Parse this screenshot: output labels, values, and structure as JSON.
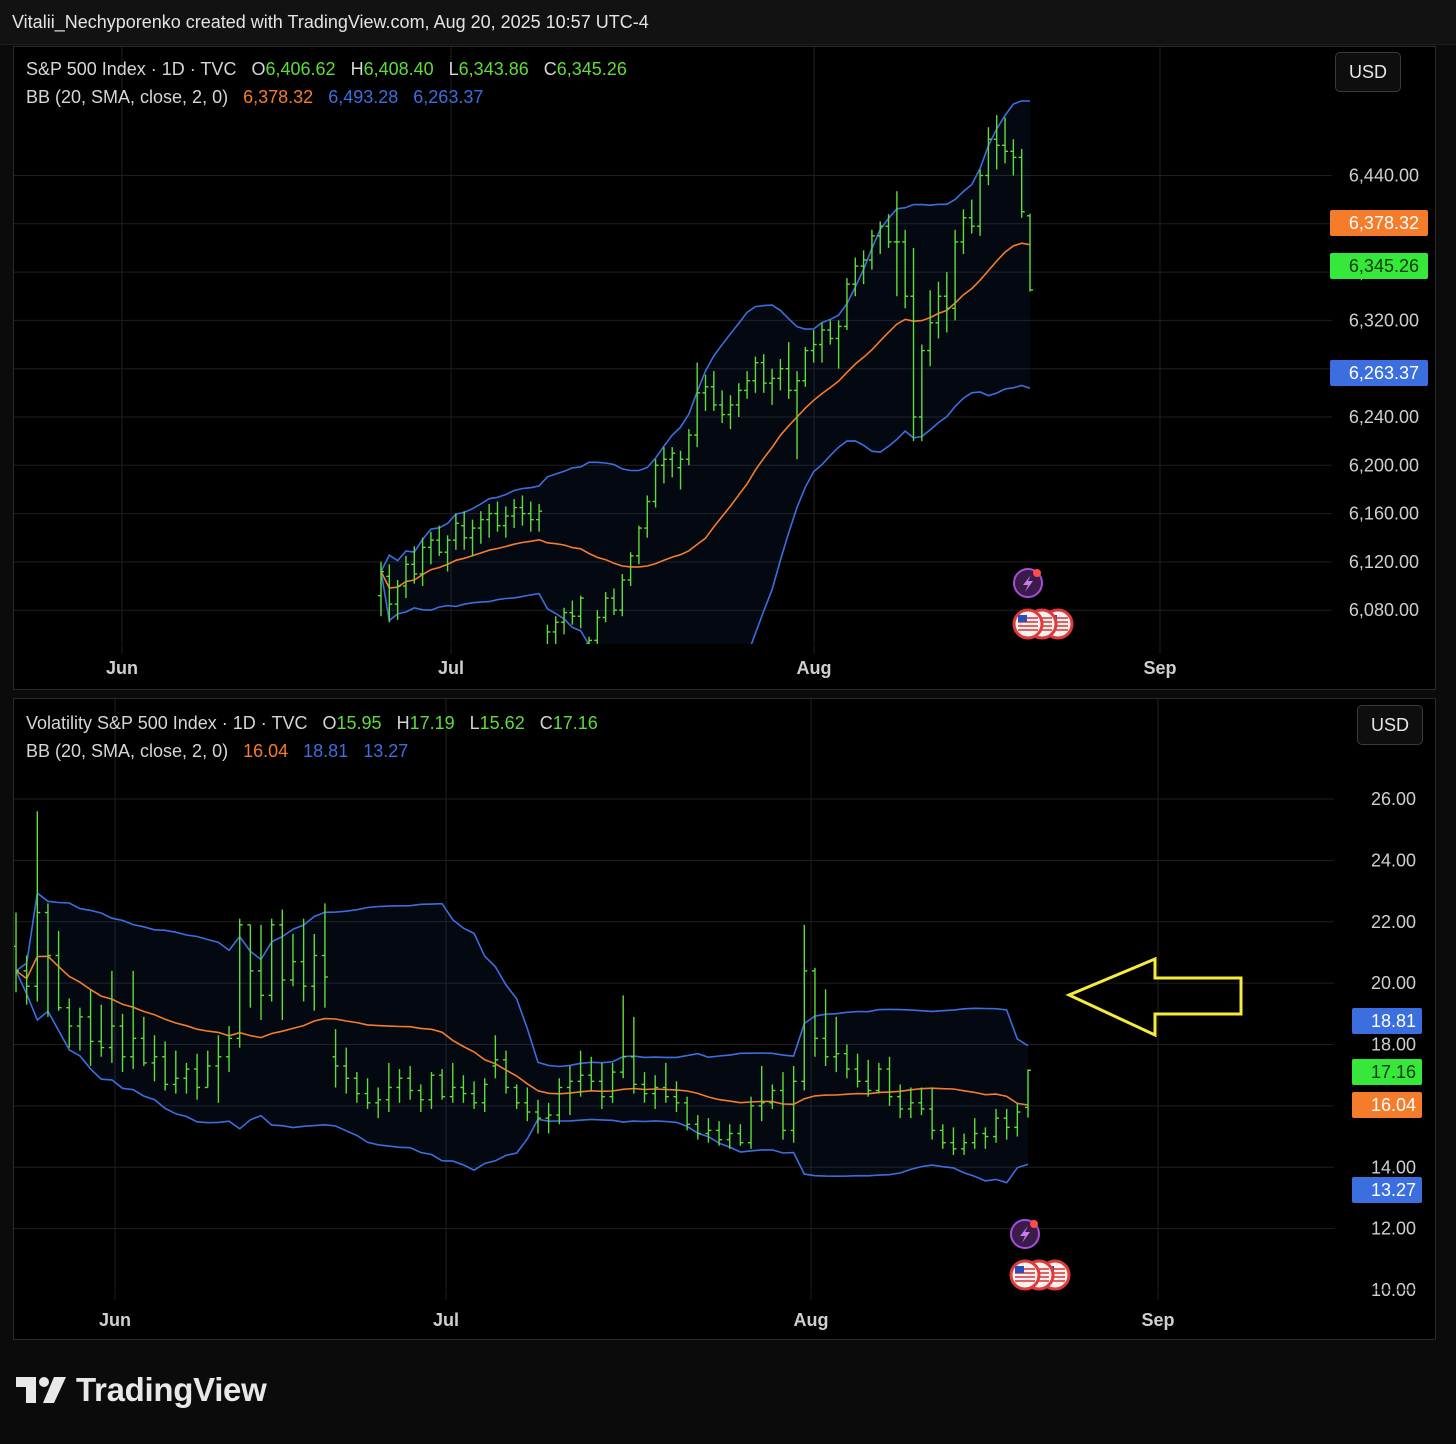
{
  "header": {
    "attribution": "Vitalii_Nechyporenko created with TradingView.com, Aug 20, 2025 10:57 UTC-4"
  },
  "branding": {
    "logo_text": "TradingView"
  },
  "colors": {
    "up_bar": "#5fdc3a",
    "bb_basis": "#f57c2a",
    "bb_band": "#3b6fe0",
    "arrow": "#f5ec3b",
    "background": "#000000"
  },
  "panels": [
    {
      "symbol_line": {
        "name": "S&P 500 Index · 1D · TVC",
        "o_label": "O",
        "o": "6,406.62",
        "h_label": "H",
        "h": "6,408.40",
        "l_label": "L",
        "l": "6,343.86",
        "c_label": "C",
        "c": "6,345.26"
      },
      "bb_line": {
        "label": "BB (20, SMA, close, 2, 0)",
        "basis": "6,378.32",
        "upper": "6,493.28",
        "lower": "6,263.37"
      },
      "currency": "USD",
      "price_tags": [
        {
          "value": "6,378.32",
          "color": "#f57c2a"
        },
        {
          "value": "6,345.26",
          "color": "#35e83a"
        },
        {
          "value": "6,263.37",
          "color": "#3b6fe0"
        }
      ]
    },
    {
      "symbol_line": {
        "name": "Volatility S&P 500 Index · 1D · TVC",
        "o_label": "O",
        "o": "15.95",
        "h_label": "H",
        "h": "17.19",
        "l_label": "L",
        "l": "15.62",
        "c_label": "C",
        "c": "17.16"
      },
      "bb_line": {
        "label": "BB (20, SMA, close, 2, 0)",
        "basis": "16.04",
        "upper": "18.81",
        "lower": "13.27"
      },
      "currency": "USD",
      "price_tags": [
        {
          "value": "18.81",
          "color": "#3b6fe0"
        },
        {
          "value": "17.16",
          "color": "#35e83a"
        },
        {
          "value": "16.04",
          "color": "#f57c2a"
        },
        {
          "value": "13.27",
          "color": "#3b6fe0"
        }
      ]
    }
  ],
  "chart_data": [
    {
      "type": "ohlc",
      "title": "S&P 500 Index · 1D · TVC",
      "x_ticks": [
        "Jun",
        "Jul",
        "Aug",
        "Sep"
      ],
      "y_ticks": [
        "6,080.00",
        "6,120.00",
        "6,160.00",
        "6,200.00",
        "6,240.00",
        "6,280.00",
        "6,320.00",
        "6,360.00",
        "6,400.00",
        "6,440.00"
      ],
      "ylim": [
        6052,
        6505
      ],
      "bar_days": [
        26,
        27,
        28,
        29,
        30,
        33,
        34,
        35,
        36,
        37,
        40,
        41,
        42,
        43,
        44,
        47,
        48,
        49,
        50,
        51,
        54,
        55,
        56,
        57,
        58,
        61,
        62,
        63,
        64,
        65,
        68,
        69,
        70,
        71,
        72,
        75,
        76,
        77,
        78,
        79,
        82,
        83,
        84,
        85,
        86,
        89,
        90,
        91,
        92,
        93,
        96,
        97,
        98,
        99,
        100,
        103,
        104,
        105,
        106,
        107,
        110,
        111,
        112,
        113,
        114,
        117,
        118,
        119,
        120,
        121,
        124,
        125,
        126,
        127,
        128,
        131,
        132,
        133,
        134,
        135,
        138,
        139,
        140,
        141,
        142,
        145,
        146,
        147,
        148,
        149,
        152,
        153,
        154,
        155,
        156,
        159,
        160,
        161,
        162,
        163,
        166,
        167,
        168,
        169,
        170,
        173,
        174,
        175,
        176,
        177,
        180,
        181,
        182,
        183,
        184,
        187,
        188,
        189,
        190,
        191,
        194,
        195,
        196,
        197,
        198,
        201,
        202,
        203,
        204,
        205,
        208,
        209,
        210,
        211,
        212,
        215,
        216,
        217,
        218,
        219,
        222,
        223,
        224,
        225,
        226,
        229,
        230,
        231,
        232
      ],
      "ohlc": [
        [
          6092,
          6120,
          6075,
          6112
        ],
        [
          6108,
          6118,
          6070,
          6085
        ],
        [
          6085,
          6105,
          6072,
          6100
        ],
        [
          6100,
          6125,
          6090,
          6118
        ],
        [
          6118,
          6133,
          6102,
          6110
        ],
        [
          6110,
          6140,
          6100,
          6132
        ],
        [
          6132,
          6145,
          6118,
          6138
        ],
        [
          6138,
          6150,
          6125,
          6128
        ],
        [
          6128,
          6142,
          6112,
          6138
        ],
        [
          6138,
          6160,
          6130,
          6152
        ],
        [
          6150,
          6162,
          6130,
          6140
        ],
        [
          6140,
          6155,
          6125,
          6148
        ],
        [
          6148,
          6162,
          6135,
          6155
        ],
        [
          6155,
          6168,
          6140,
          6160
        ],
        [
          6160,
          6170,
          6145,
          6150
        ],
        [
          6150,
          6166,
          6140,
          6158
        ],
        [
          6158,
          6172,
          6148,
          6165
        ],
        [
          6165,
          6175,
          6150,
          6160
        ],
        [
          6160,
          6170,
          6145,
          6155
        ],
        [
          6155,
          6168,
          6145,
          6162
        ],
        [
          6050,
          6068,
          6040,
          6062
        ],
        [
          6062,
          6075,
          6050,
          6070
        ],
        [
          6070,
          6082,
          6060,
          6078
        ],
        [
          6078,
          6088,
          6068,
          6075
        ],
        [
          6075,
          6092,
          6065,
          6090
        ],
        [
          6052,
          6058,
          6032,
          6055
        ],
        [
          6055,
          6080,
          6048,
          6074
        ],
        [
          6074,
          6095,
          6070,
          6090
        ],
        [
          6090,
          6098,
          6076,
          6080
        ],
        [
          6080,
          6110,
          6075,
          6105
        ],
        [
          6105,
          6128,
          6100,
          6125
        ],
        [
          6125,
          6150,
          6118,
          6148
        ],
        [
          6148,
          6175,
          6140,
          6170
        ],
        [
          6170,
          6205,
          6165,
          6200
        ],
        [
          6200,
          6215,
          6185,
          6205
        ],
        [
          6205,
          6215,
          6190,
          6210
        ],
        [
          6198,
          6212,
          6180,
          6205
        ],
        [
          6205,
          6230,
          6200,
          6225
        ],
        [
          6225,
          6285,
          6215,
          6260
        ],
        [
          6260,
          6275,
          6245,
          6265
        ],
        [
          6265,
          6278,
          6245,
          6250
        ],
        [
          6250,
          6262,
          6235,
          6242
        ],
        [
          6242,
          6258,
          6230,
          6250
        ],
        [
          6250,
          6268,
          6240,
          6262
        ],
        [
          6262,
          6278,
          6255,
          6270
        ],
        [
          6270,
          6290,
          6260,
          6285
        ],
        [
          6285,
          6292,
          6260,
          6268
        ],
        [
          6268,
          6280,
          6250,
          6272
        ],
        [
          6272,
          6288,
          6262,
          6280
        ],
        [
          6280,
          6302,
          6255,
          6262
        ],
        [
          6262,
          6278,
          6205,
          6270
        ],
        [
          6270,
          6298,
          6265,
          6295
        ],
        [
          6295,
          6312,
          6285,
          6300
        ],
        [
          6300,
          6318,
          6285,
          6312
        ],
        [
          6312,
          6320,
          6300,
          6305
        ],
        [
          6305,
          6320,
          6280,
          6315
        ],
        [
          6315,
          6355,
          6312,
          6350
        ],
        [
          6350,
          6372,
          6340,
          6365
        ],
        [
          6365,
          6378,
          6350,
          6370
        ],
        [
          6370,
          6395,
          6362,
          6390
        ],
        [
          6390,
          6402,
          6375,
          6398
        ],
        [
          6398,
          6408,
          6380,
          6385
        ],
        [
          6385,
          6427,
          6340,
          6385
        ],
        [
          6385,
          6395,
          6330,
          6340
        ],
        [
          6340,
          6380,
          6220,
          6240
        ],
        [
          6240,
          6300,
          6220,
          6295
        ],
        [
          6295,
          6345,
          6282,
          6318
        ],
        [
          6318,
          6352,
          6305,
          6340
        ],
        [
          6340,
          6360,
          6310,
          6330
        ],
        [
          6330,
          6395,
          6320,
          6385
        ],
        [
          6385,
          6412,
          6375,
          6405
        ],
        [
          6405,
          6420,
          6392,
          6398
        ],
        [
          6398,
          6445,
          6390,
          6440
        ],
        [
          6440,
          6480,
          6432,
          6470
        ],
        [
          6470,
          6490,
          6445,
          6465
        ],
        [
          6465,
          6488,
          6450,
          6460
        ],
        [
          6460,
          6470,
          6440,
          6455
        ],
        [
          6455,
          6462,
          6405,
          6410
        ],
        [
          6406.62,
          6408.4,
          6343.86,
          6345.26
        ]
      ],
      "bollinger": {
        "basis_label": "6,378.32",
        "upper_label": "6,493.28",
        "lower_label": "6,263.37"
      }
    },
    {
      "type": "ohlc",
      "title": "Volatility S&P 500 Index · 1D · TVC",
      "x_ticks": [
        "Jun",
        "Jul",
        "Aug",
        "Sep"
      ],
      "y_ticks": [
        "10.00",
        "12.00",
        "14.00",
        "16.00",
        "18.00",
        "20.00",
        "22.00",
        "24.00",
        "26.00"
      ],
      "ylim": [
        10.0,
        27.2
      ],
      "annotation": "yellow left-pointing arrow at VIX 20",
      "ohlc": [
        [
          21.2,
          22.3,
          19.7,
          20.4
        ],
        [
          20.4,
          20.9,
          19.3,
          19.9
        ],
        [
          19.9,
          25.6,
          19.4,
          22.3
        ],
        [
          22.3,
          22.6,
          18.9,
          20.9
        ],
        [
          20.9,
          21.7,
          19.1,
          19.2
        ],
        [
          19.2,
          19.5,
          17.9,
          18.6
        ],
        [
          18.6,
          19.2,
          17.8,
          18.9
        ],
        [
          18.9,
          19.8,
          17.3,
          18.1
        ],
        [
          18.1,
          19.3,
          17.6,
          17.9
        ],
        [
          17.9,
          20.4,
          17.4,
          18.6
        ],
        [
          18.6,
          19.0,
          17.1,
          17.6
        ],
        [
          17.6,
          20.4,
          17.2,
          18.2
        ],
        [
          18.2,
          18.9,
          17.3,
          17.4
        ],
        [
          17.4,
          18.3,
          16.8,
          17.6
        ],
        [
          17.6,
          18.1,
          16.5,
          16.7
        ],
        [
          16.7,
          17.8,
          16.4,
          16.9
        ],
        [
          16.9,
          17.4,
          16.4,
          17.2
        ],
        [
          17.2,
          17.7,
          16.2,
          16.6
        ],
        [
          16.6,
          17.8,
          16.6,
          17.3
        ],
        [
          17.3,
          18.3,
          16.1,
          17.6
        ],
        [
          17.6,
          18.6,
          17.1,
          18.2
        ],
        [
          18.2,
          22.1,
          17.9,
          21.9
        ],
        [
          21.9,
          21.9,
          19.2,
          20.4
        ],
        [
          20.4,
          21.9,
          18.8,
          19.6
        ],
        [
          19.6,
          22.1,
          19.4,
          21.9
        ],
        [
          21.9,
          22.4,
          18.8,
          20.1
        ],
        [
          20.1,
          21.6,
          19.9,
          20.7
        ],
        [
          20.7,
          22.1,
          19.4,
          19.9
        ],
        [
          19.9,
          21.6,
          19.1,
          20.9
        ],
        [
          20.9,
          22.6,
          19.2,
          20.2
        ],
        [
          17.6,
          18.5,
          16.6,
          17.3
        ],
        [
          17.3,
          17.9,
          16.4,
          16.9
        ],
        [
          16.9,
          17.1,
          16.1,
          16.4
        ],
        [
          16.4,
          16.9,
          15.9,
          16.1
        ],
        [
          16.1,
          16.6,
          15.6,
          16.2
        ],
        [
          16.2,
          17.4,
          15.8,
          16.6
        ],
        [
          16.6,
          17.2,
          16.1,
          16.9
        ],
        [
          16.9,
          17.3,
          16.2,
          16.5
        ],
        [
          16.5,
          16.7,
          15.8,
          16.2
        ],
        [
          16.2,
          17.1,
          15.9,
          17.0
        ],
        [
          17.0,
          17.2,
          16.2,
          16.3
        ],
        [
          16.3,
          17.4,
          16.1,
          16.6
        ],
        [
          16.6,
          17.0,
          16.1,
          16.4
        ],
        [
          16.4,
          16.8,
          15.9,
          16.1
        ],
        [
          16.1,
          16.9,
          15.8,
          16.7
        ],
        [
          17.3,
          18.3,
          16.9,
          17.5
        ],
        [
          17.5,
          17.8,
          16.4,
          16.6
        ],
        [
          16.6,
          16.7,
          15.9,
          16.1
        ],
        [
          16.1,
          16.6,
          15.5,
          15.8
        ],
        [
          15.8,
          16.2,
          15.1,
          15.6
        ],
        [
          15.6,
          16.1,
          15.1,
          15.7
        ],
        [
          15.7,
          16.9,
          15.4,
          16.6
        ],
        [
          16.6,
          17.3,
          15.7,
          16.8
        ],
        [
          16.8,
          17.8,
          16.3,
          17.0
        ],
        [
          17.0,
          17.6,
          16.5,
          16.8
        ],
        [
          16.8,
          17.4,
          15.9,
          16.3
        ],
        [
          16.3,
          17.4,
          16.1,
          17.1
        ],
        [
          17.1,
          19.6,
          16.9,
          17.6
        ],
        [
          17.6,
          18.9,
          16.4,
          16.7
        ],
        [
          16.7,
          17.1,
          16.1,
          16.4
        ],
        [
          16.4,
          17.0,
          15.9,
          16.6
        ],
        [
          16.6,
          17.4,
          16.1,
          16.3
        ],
        [
          16.3,
          16.8,
          15.8,
          16.1
        ],
        [
          16.1,
          16.3,
          15.2,
          15.4
        ],
        [
          15.4,
          15.7,
          14.9,
          15.1
        ],
        [
          15.1,
          15.6,
          14.8,
          15.2
        ],
        [
          15.2,
          15.5,
          14.7,
          14.9
        ],
        [
          14.9,
          15.4,
          14.6,
          15.1
        ],
        [
          15.1,
          15.4,
          14.7,
          14.8
        ],
        [
          14.8,
          16.3,
          14.6,
          16.0
        ],
        [
          16.0,
          17.3,
          15.5,
          16.1
        ],
        [
          16.1,
          16.7,
          15.9,
          16.5
        ],
        [
          16.5,
          17.1,
          14.9,
          15.2
        ],
        [
          15.2,
          17.3,
          14.8,
          16.8
        ],
        [
          16.8,
          21.9,
          16.5,
          20.4
        ],
        [
          20.4,
          20.5,
          17.6,
          18.2
        ],
        [
          18.2,
          19.8,
          17.3,
          17.6
        ],
        [
          17.6,
          18.9,
          17.1,
          17.7
        ],
        [
          17.7,
          18.0,
          16.9,
          17.2
        ],
        [
          17.2,
          17.7,
          16.6,
          16.8
        ],
        [
          16.8,
          17.5,
          16.3,
          16.5
        ],
        [
          16.5,
          17.4,
          16.4,
          17.2
        ],
        [
          17.2,
          17.6,
          16.0,
          16.3
        ],
        [
          16.3,
          16.7,
          15.6,
          15.9
        ],
        [
          15.9,
          16.6,
          15.6,
          16.1
        ],
        [
          16.1,
          16.6,
          15.7,
          15.9
        ],
        [
          15.9,
          16.6,
          14.9,
          15.2
        ],
        [
          15.2,
          15.4,
          14.6,
          14.8
        ],
        [
          14.8,
          15.3,
          14.4,
          14.6
        ],
        [
          14.6,
          15.1,
          14.4,
          14.8
        ],
        [
          14.8,
          15.6,
          14.6,
          15.1
        ],
        [
          15.1,
          15.3,
          14.6,
          15.0
        ],
        [
          15.0,
          15.9,
          14.8,
          15.6
        ],
        [
          15.6,
          15.9,
          14.9,
          15.3
        ],
        [
          15.3,
          16.1,
          15.0,
          15.8
        ],
        [
          15.95,
          17.19,
          15.62,
          17.16
        ]
      ],
      "bollinger": {
        "basis_label": "16.04",
        "upper_label": "18.81",
        "lower_label": "13.27"
      }
    }
  ]
}
